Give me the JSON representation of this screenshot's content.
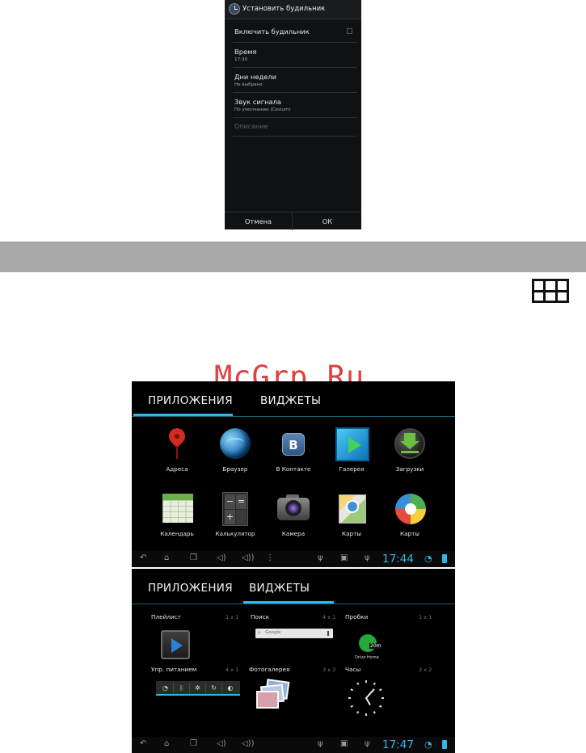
{
  "alarm_dialog": {
    "title": "Установить будильник",
    "enable_label": "Включить будильник",
    "time_label": "Время",
    "time_value": "17:30",
    "days_label": "Дни недели",
    "days_value": "Не выбрано",
    "sound_label": "Звук сигнала",
    "sound_value": "По умолчанию (Cesium)",
    "description_placeholder": "Описание",
    "cancel_label": "Отмена",
    "ok_label": "ОК"
  },
  "watermark": "McGrp.Ru",
  "screen_apps": {
    "tab_apps": "ПРИЛОЖЕНИЯ",
    "tab_widgets": "ВИДЖЕТЫ",
    "apps": [
      {
        "label": "Адреса",
        "icon": "maps-pin-icon"
      },
      {
        "label": "Браузер",
        "icon": "globe-icon"
      },
      {
        "label": "В Контакте",
        "icon": "vk-icon"
      },
      {
        "label": "Галерея",
        "icon": "gallery-icon"
      },
      {
        "label": "Загрузки",
        "icon": "download-icon"
      },
      {
        "label": "Календарь",
        "icon": "calendar-icon"
      },
      {
        "label": "Калькулятор",
        "icon": "calculator-icon"
      },
      {
        "label": "Камера",
        "icon": "camera-icon"
      },
      {
        "label": "Карты",
        "icon": "maps-icon"
      },
      {
        "label": "Карты",
        "icon": "navigation-icon"
      }
    ],
    "clock": "17:44"
  },
  "screen_widgets": {
    "tab_apps": "ПРИЛОЖЕНИЯ",
    "tab_widgets": "ВИДЖЕТЫ",
    "widgets": [
      {
        "title": "Плейлист",
        "size": "1 x 1"
      },
      {
        "title": "Поиск",
        "size": "4 x 1"
      },
      {
        "title": "Пробки",
        "size": "1 x 1"
      },
      {
        "title": "Упр. питанием",
        "size": "4 x 1"
      },
      {
        "title": "Фотогалерея",
        "size": "3 x 3"
      },
      {
        "title": "Часы",
        "size": "2 x 2"
      }
    ],
    "search_text": "Google",
    "traffic_minutes": "20m",
    "traffic_label": "Drive Home",
    "clock": "17:47"
  },
  "colors": {
    "accent": "#33b5e5",
    "band": "#a8a8a8",
    "watermark": "#d92020"
  }
}
